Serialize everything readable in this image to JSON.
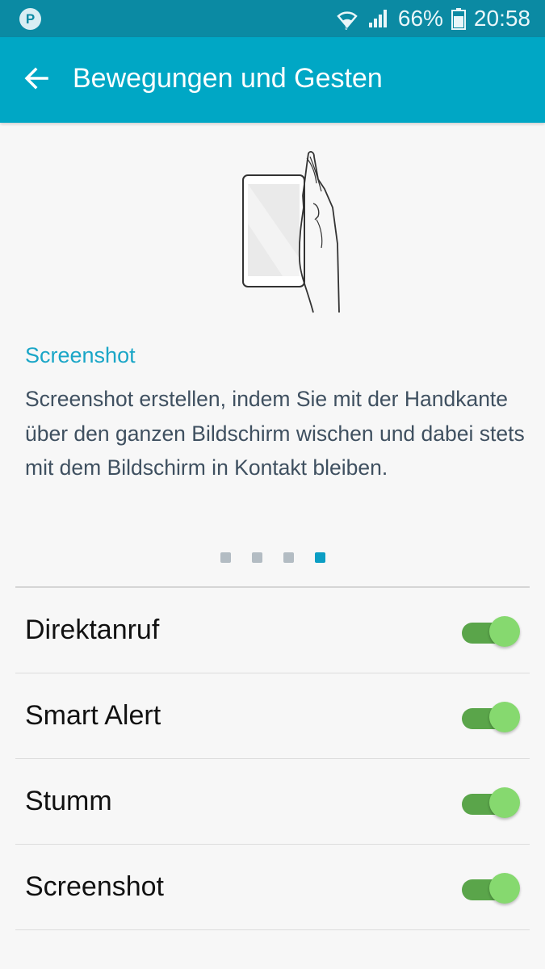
{
  "status_bar": {
    "app_icon": "P",
    "battery_percent": "66%",
    "time": "20:58",
    "icons": [
      "wifi-icon",
      "signal-icon",
      "battery-icon"
    ]
  },
  "app_bar": {
    "title": "Bewegungen und Gesten",
    "back_icon": "arrow-left-icon"
  },
  "feature": {
    "illustration": "hand-swipe-screenshot-illustration",
    "title": "Screenshot",
    "description": "Screenshot erstellen, indem Sie mit der Handkante über den ganzen Bildschirm wischen und dabei stets mit dem Bildschirm in Kontakt bleiben."
  },
  "pager": {
    "total": 4,
    "active_index": 3
  },
  "settings": [
    {
      "label": "Direktanruf",
      "enabled": true
    },
    {
      "label": "Smart Alert",
      "enabled": true
    },
    {
      "label": "Stumm",
      "enabled": true
    },
    {
      "label": "Screenshot",
      "enabled": true
    }
  ],
  "colors": {
    "status_bar": "#0b8aa3",
    "app_bar": "#00a7c5",
    "accent": "#1aa6c7",
    "switch_track": "#5aa54a",
    "switch_thumb": "#86d96f"
  }
}
